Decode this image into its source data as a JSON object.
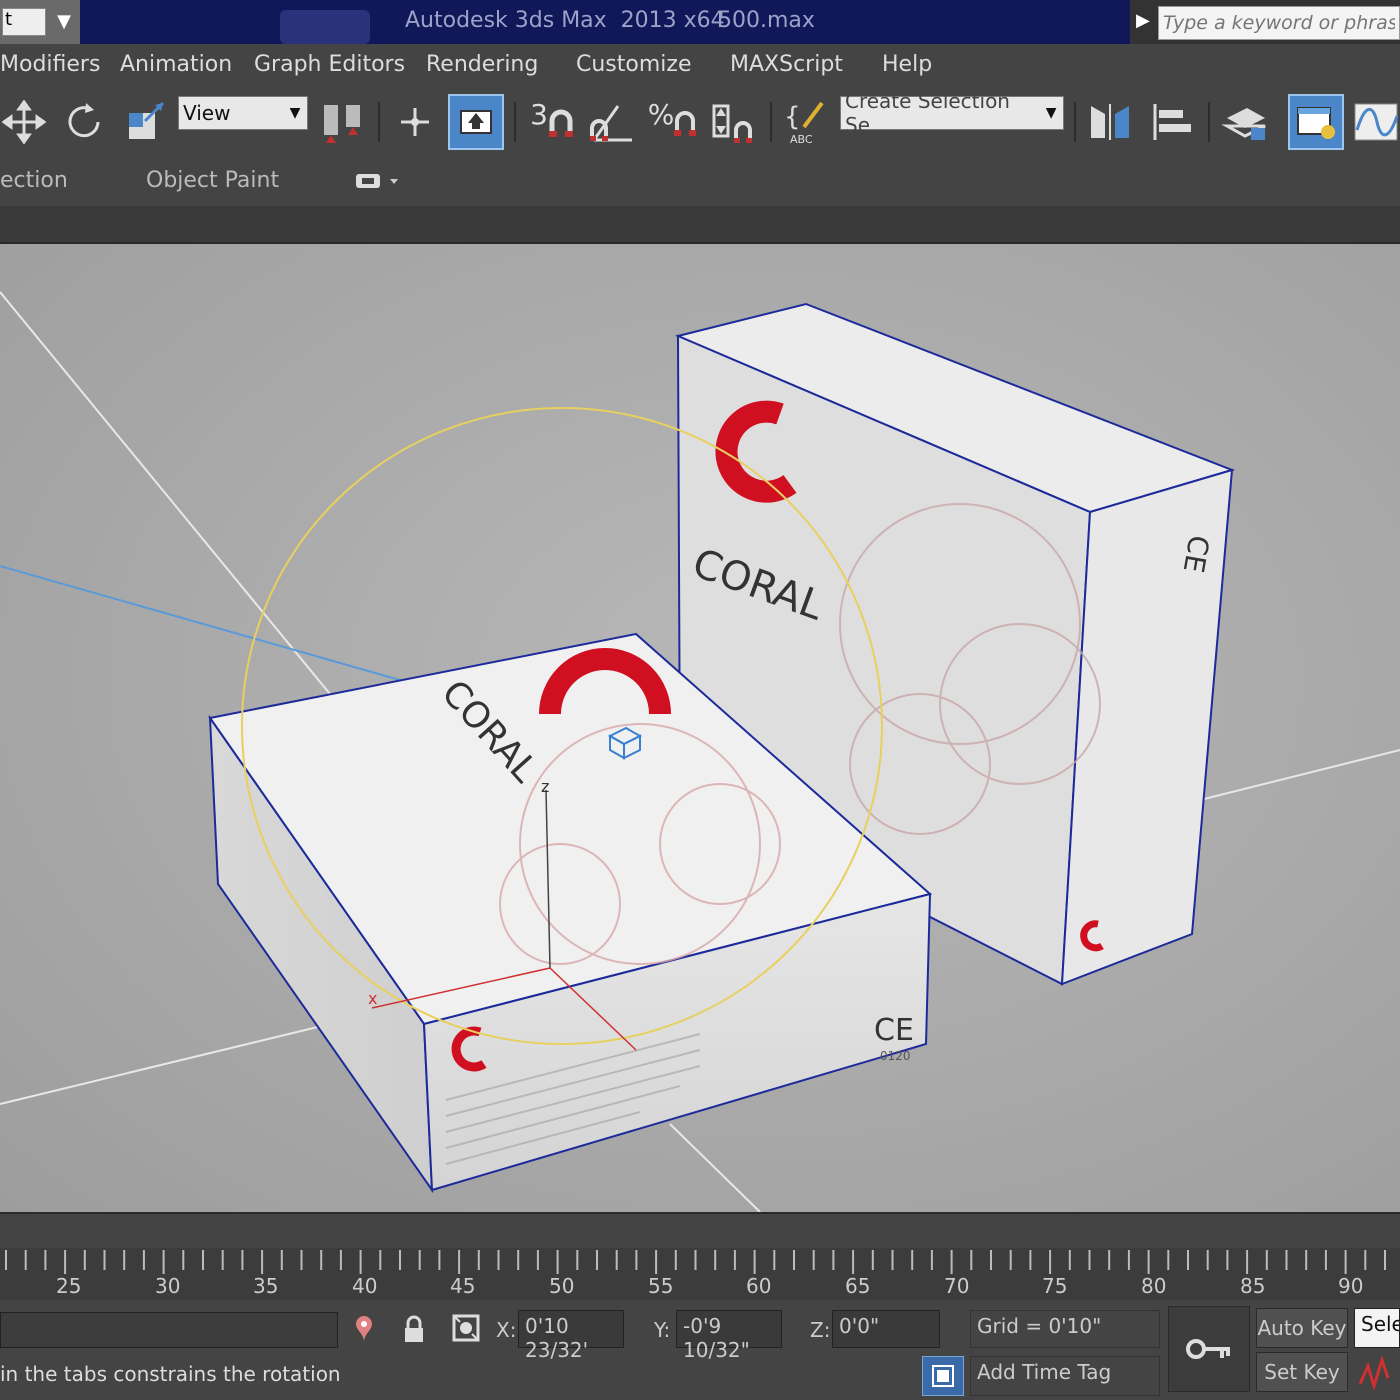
{
  "title_bar": {
    "quick_access_value": "t",
    "app_title": "Autodesk 3ds Max  2013 x64",
    "file_name": "500.max",
    "search_placeholder": "Type a keyword or phrase"
  },
  "menu": {
    "items": [
      "Modifiers",
      "Animation",
      "Graph Editors",
      "Rendering",
      "Customize",
      "MAXScript",
      "Help"
    ]
  },
  "toolbar": {
    "reference_coord_value": "View",
    "snap_label": "3",
    "percent_snap_label": "%",
    "named_selection_value": "Create Selection Se"
  },
  "ribbon": {
    "tabs": [
      "ection",
      "Object Paint"
    ]
  },
  "viewport": {
    "axis_z": "z",
    "axis_x": "x",
    "brand_text": "CORAL",
    "ce_mark": "CE",
    "ce_number": "0120"
  },
  "timeline": {
    "ticks": [
      "25",
      "30",
      "35",
      "40",
      "45",
      "50",
      "55",
      "60",
      "65",
      "70",
      "75",
      "80",
      "85",
      "90"
    ]
  },
  "status": {
    "x_label": "X:",
    "x_value": "0'10 23/32'",
    "y_label": "Y:",
    "y_value": "-0'9 10/32\"",
    "z_label": "Z:",
    "z_value": "0'0\"",
    "grid": "Grid = 0'10\"",
    "auto_key": "Auto Key",
    "set_key": "Set Key",
    "selected_value": "Sele",
    "prompt": "in the tabs constrains the rotation",
    "add_time_tag": "Add Time Tag"
  },
  "colors": {
    "title_bg": "#10185a",
    "ui_bg": "#444444",
    "viewport_bg": "#a9a9a9",
    "selected_button": "#4a86c8",
    "brand_red": "#d01020",
    "gizmo_yellow": "#e8d060",
    "edge_blue": "#1c2a9a"
  }
}
